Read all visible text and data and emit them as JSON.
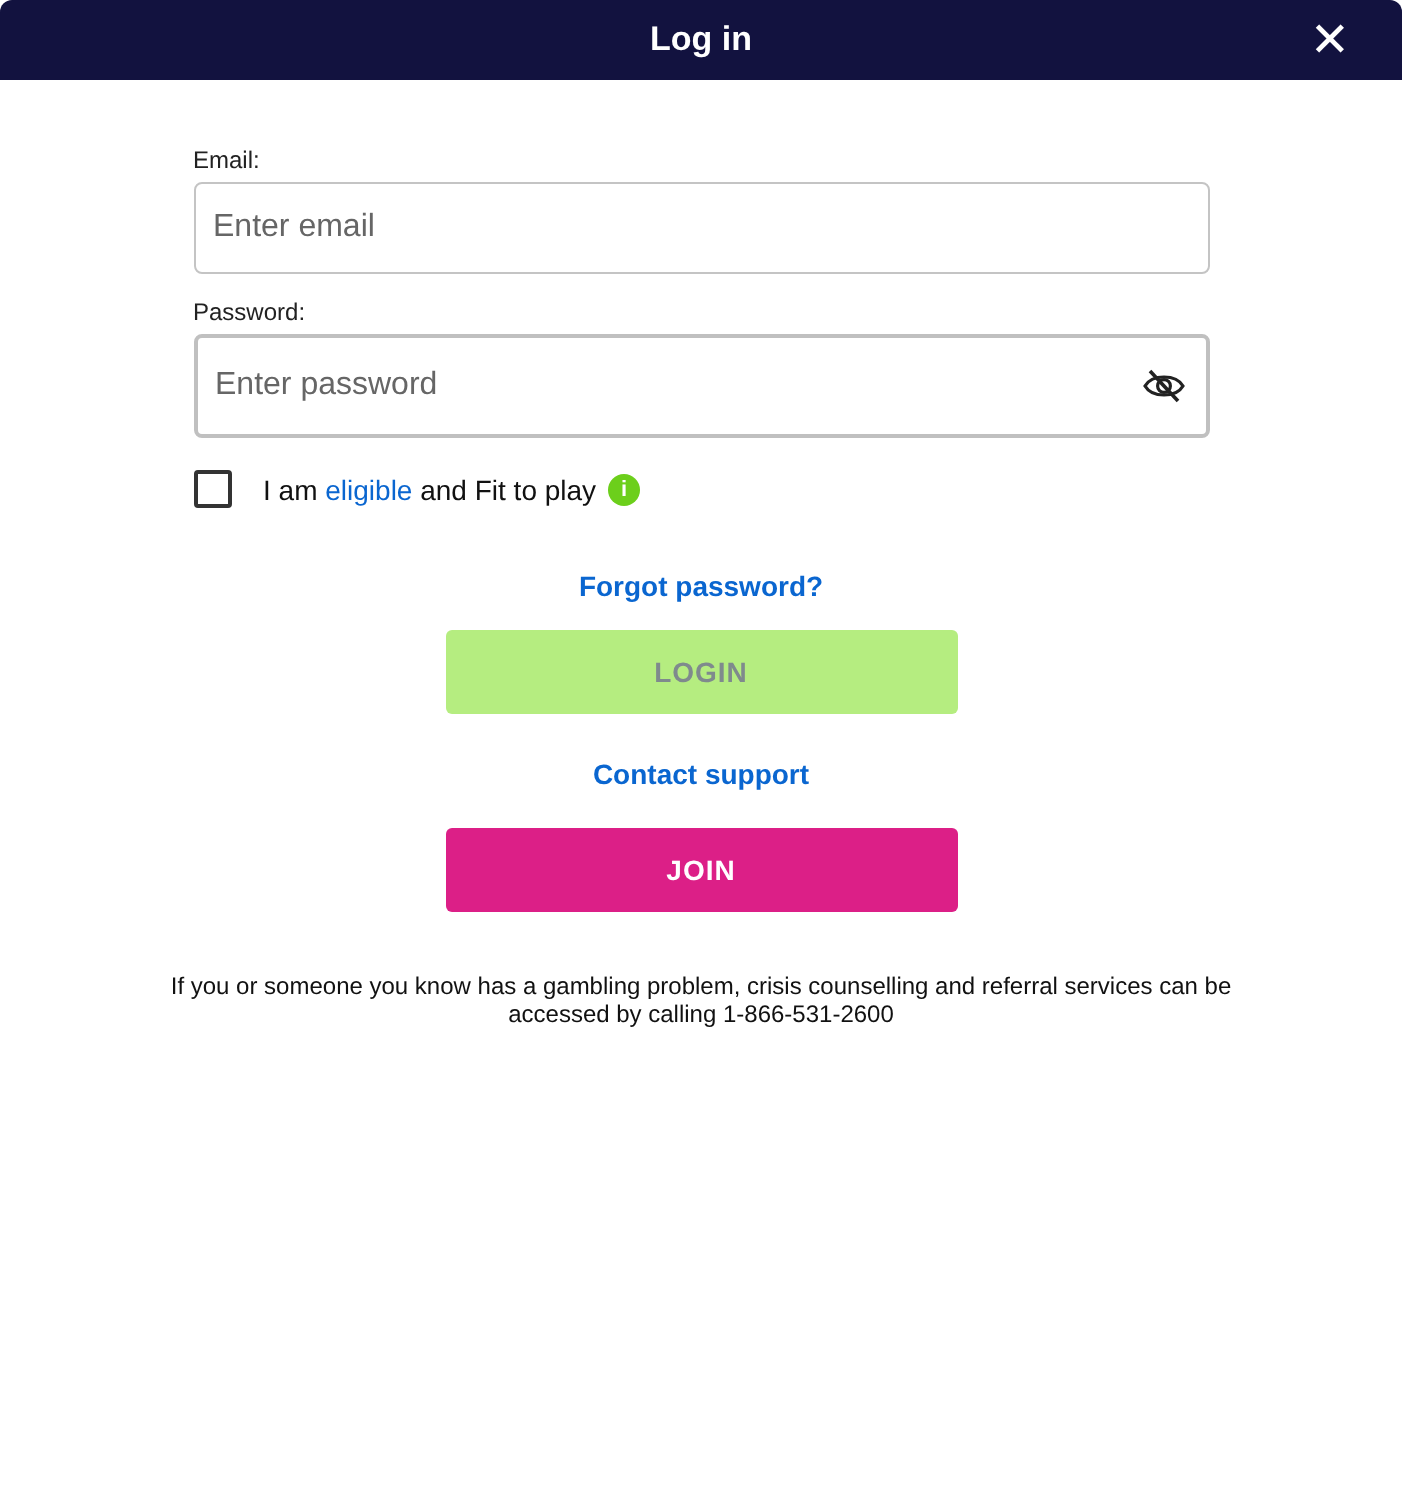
{
  "window": {
    "title": "Log in",
    "close": "✕"
  },
  "email": {
    "label": "Email:",
    "placeholder": "Enter email"
  },
  "password": {
    "label": "Password:",
    "placeholder": "Enter password"
  },
  "eligibility": {
    "checked": false,
    "before": "I am",
    "link": "eligible",
    "after": "and Fit to play",
    "info": "i"
  },
  "forgot_link": "Forgot password?",
  "login_button": {
    "label": "LOGIN",
    "disabled": true
  },
  "support_link": "Contact support",
  "join_button": {
    "label": "JOIN"
  },
  "disclaimer": "If you or someone you know has a gambling problem, crisis counselling and referral services can be accessed by calling 1-866-531-2600"
}
